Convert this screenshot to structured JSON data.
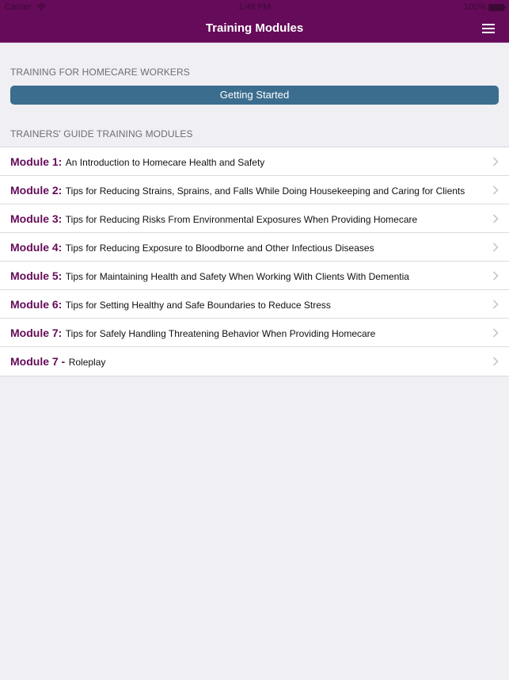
{
  "status_bar": {
    "carrier": "Carrier",
    "time": "1:48 PM",
    "battery": "100%"
  },
  "nav": {
    "title": "Training Modules"
  },
  "sections": [
    {
      "header": "TRAINING FOR HOMECARE WORKERS",
      "button_label": "Getting Started"
    },
    {
      "header": "TRAINERS' GUIDE TRAINING MODULES"
    }
  ],
  "modules": [
    {
      "num": "Module 1:",
      "desc": "An Introduction to Homecare Health and Safety"
    },
    {
      "num": "Module 2:",
      "desc": "Tips for Reducing Strains, Sprains, and Falls While Doing Housekeeping and Caring for Clients"
    },
    {
      "num": "Module 3:",
      "desc": "Tips for Reducing Risks From Environmental Exposures When Providing Homecare"
    },
    {
      "num": "Module 4:",
      "desc": "Tips for Reducing Exposure to Bloodborne and Other Infectious Diseases"
    },
    {
      "num": "Module 5:",
      "desc": "Tips for Maintaining Health and Safety When Working With Clients With Dementia"
    },
    {
      "num": "Module 6:",
      "desc": "Tips for Setting Healthy and Safe Boundaries to Reduce Stress"
    },
    {
      "num": "Module 7:",
      "desc": "Tips for Safely Handling Threatening Behavior When Providing Homecare"
    },
    {
      "num": "Module 7 -",
      "desc": "Roleplay"
    }
  ],
  "colors": {
    "nav_background": "#650b59",
    "accent_purple": "#650b59",
    "button_blue": "#3b6d8f",
    "page_background": "#efeff4"
  }
}
